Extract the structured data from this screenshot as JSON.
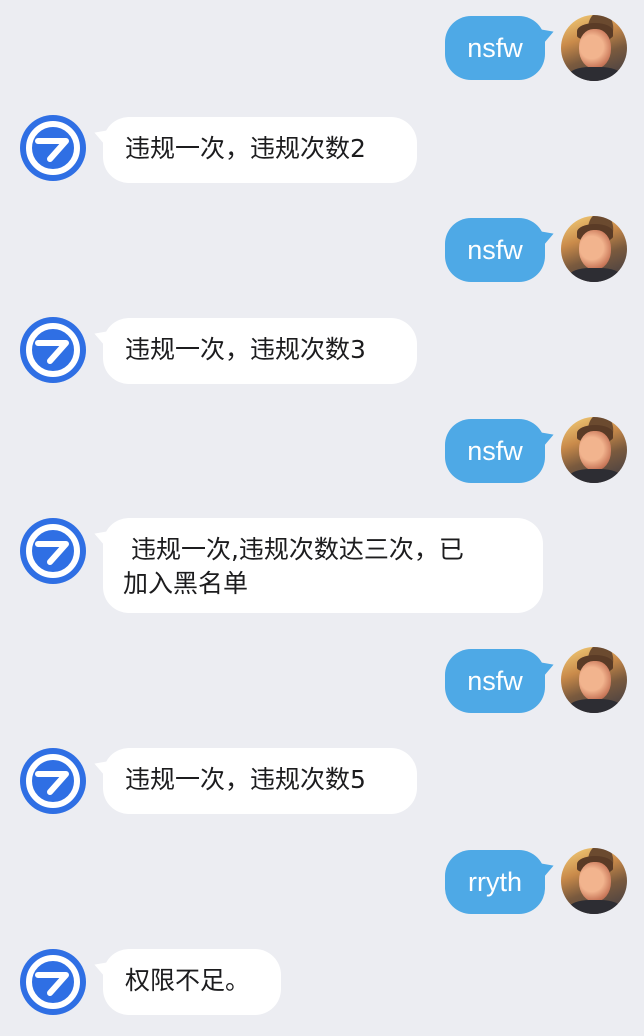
{
  "messages": [
    {
      "sender": "user",
      "text": "nsfw",
      "avatar": "user-avatar"
    },
    {
      "sender": "bot",
      "text": "违规一次，违规次数2",
      "avatar": "bot-logo-icon"
    },
    {
      "sender": "user",
      "text": "nsfw",
      "avatar": "user-avatar"
    },
    {
      "sender": "bot",
      "text": "违规一次，违规次数3",
      "avatar": "bot-logo-icon"
    },
    {
      "sender": "user",
      "text": "nsfw",
      "avatar": "user-avatar"
    },
    {
      "sender": "bot",
      "text": " 违规一次,违规次数达三次，已\n加入黑名单",
      "avatar": "bot-logo-icon"
    },
    {
      "sender": "user",
      "text": "nsfw",
      "avatar": "user-avatar"
    },
    {
      "sender": "bot",
      "text": "违规一次，违规次数5",
      "avatar": "bot-logo-icon"
    },
    {
      "sender": "user",
      "text": "rryth",
      "avatar": "user-avatar"
    },
    {
      "sender": "bot",
      "text": "权限不足。",
      "avatar": "bot-logo-icon"
    }
  ],
  "colors": {
    "background": "#ecedf2",
    "user_bubble": "#4ea9e6",
    "bot_bubble": "#ffffff",
    "bot_avatar": "#2f6fe4"
  }
}
